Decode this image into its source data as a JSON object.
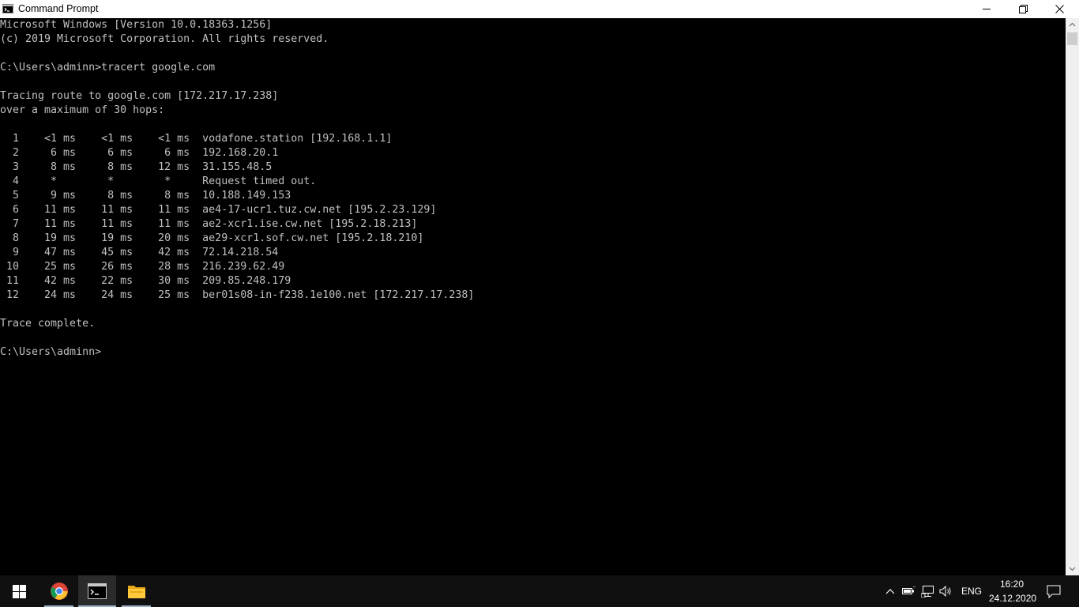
{
  "window": {
    "title": "Command Prompt",
    "icons": {
      "app": "cmd-app-icon",
      "minimize": "minimize-icon",
      "maximize": "restore-icon",
      "close": "close-icon"
    }
  },
  "console": {
    "lines": [
      "Microsoft Windows [Version 10.0.18363.1256]",
      "(c) 2019 Microsoft Corporation. All rights reserved.",
      "",
      "C:\\Users\\adminn>tracert google.com",
      "",
      "Tracing route to google.com [172.217.17.238]",
      "over a maximum of 30 hops:",
      "",
      "  1    <1 ms    <1 ms    <1 ms  vodafone.station [192.168.1.1]",
      "  2     6 ms     6 ms     6 ms  192.168.20.1",
      "  3     8 ms     8 ms    12 ms  31.155.48.5",
      "  4     *        *        *     Request timed out.",
      "  5     9 ms     8 ms     8 ms  10.188.149.153",
      "  6    11 ms    11 ms    11 ms  ae4-17-ucr1.tuz.cw.net [195.2.23.129]",
      "  7    11 ms    11 ms    11 ms  ae2-xcr1.ise.cw.net [195.2.18.213]",
      "  8    19 ms    19 ms    20 ms  ae29-xcr1.sof.cw.net [195.2.18.210]",
      "  9    47 ms    45 ms    42 ms  72.14.218.54",
      " 10    25 ms    26 ms    28 ms  216.239.62.49",
      " 11    42 ms    22 ms    30 ms  209.85.248.179",
      " 12    24 ms    24 ms    25 ms  ber01s08-in-f238.1e100.net [172.217.17.238]",
      "",
      "Trace complete.",
      "",
      "C:\\Users\\adminn>"
    ],
    "text_color": "#c0c0c0",
    "background_color": "#000000"
  },
  "taskbar": {
    "apps": [
      {
        "name": "start",
        "icon": "windows-logo-icon"
      },
      {
        "name": "chrome",
        "icon": "chrome-icon"
      },
      {
        "name": "command-prompt",
        "icon": "cmd-icon",
        "active": true
      },
      {
        "name": "file-explorer",
        "icon": "folder-icon"
      }
    ],
    "tray": {
      "icons": [
        "chevron-up-icon",
        "battery-icon",
        "network-icon",
        "volume-icon"
      ],
      "language": "ENG",
      "time": "16:20",
      "date": "24.12.2020",
      "notification_icon": "action-center-icon"
    }
  }
}
